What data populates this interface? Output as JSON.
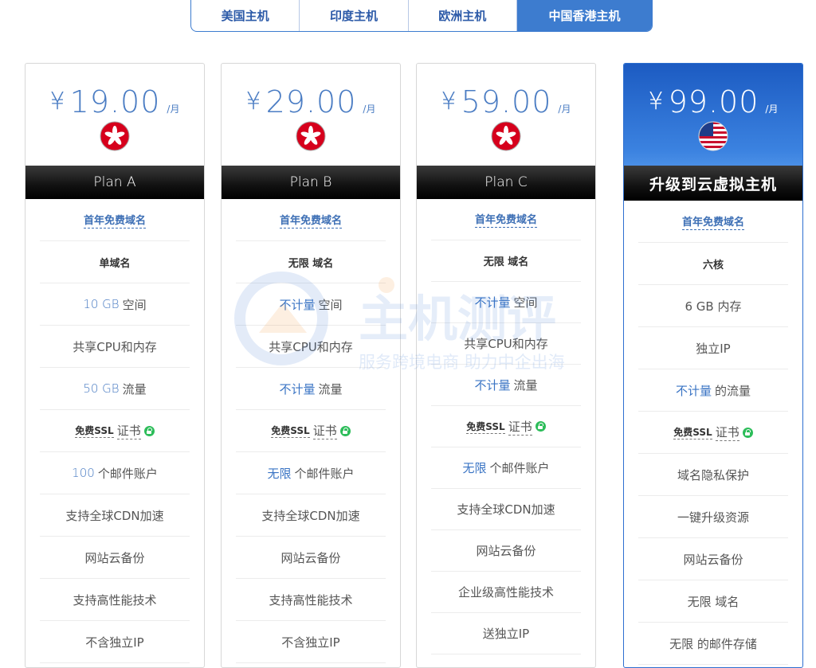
{
  "tabs": [
    {
      "label": "美国主机",
      "active": false
    },
    {
      "label": "印度主机",
      "active": false
    },
    {
      "label": "欧洲主机",
      "active": false
    },
    {
      "label": "中国香港主机",
      "active": true
    }
  ],
  "colors": {
    "accent": "#3d7ccf",
    "feature_blue": "#4a7cc3",
    "featured_header": "#1c5bc2",
    "ssl_green": "#2dbd5a"
  },
  "watermark": {
    "title": "主机测评",
    "subtitle": "服务跨境电商 助力中企出海"
  },
  "cards": [
    {
      "currency": "¥",
      "price": "19.00",
      "period": "/月",
      "flag": "hong-kong-flag-icon",
      "plan": "Plan A",
      "features": {
        "domain_link": "首年免费域名",
        "domains": "单域名",
        "storage_value": "10 GB",
        "storage_label": "空间",
        "cpu": "共享CPU和内存",
        "traffic_value": "50 GB",
        "traffic_label": "流量",
        "ssl_tag": "免费SSL",
        "ssl_label": "证书",
        "email_value": "100",
        "email_label": "个邮件账户",
        "f8": "支持全球CDN加速",
        "f9": "网站云备份",
        "f10": "支持高性能技术",
        "f11": "不含独立IP"
      }
    },
    {
      "currency": "¥",
      "price": "29.00",
      "period": "/月",
      "flag": "hong-kong-flag-icon",
      "plan": "Plan B",
      "features": {
        "domain_link": "首年免费域名",
        "domains": "无限 域名",
        "storage_value": "不计量",
        "storage_label": "空间",
        "cpu": "共享CPU和内存",
        "traffic_value": "不计量",
        "traffic_label": "流量",
        "ssl_tag": "免费SSL",
        "ssl_label": "证书",
        "email_value": "无限",
        "email_label": "个邮件账户",
        "f8": "支持全球CDN加速",
        "f9": "网站云备份",
        "f10": "支持高性能技术",
        "f11": "不含独立IP"
      }
    },
    {
      "currency": "¥",
      "price": "59.00",
      "period": "/月",
      "flag": "hong-kong-flag-icon",
      "plan": "Plan C",
      "features": {
        "domain_link": "首年免费域名",
        "domains": "无限 域名",
        "storage_value": "不计量",
        "storage_label": "空间",
        "cpu": "共享CPU和内存",
        "traffic_value": "不计量",
        "traffic_label": "流量",
        "ssl_tag": "免费SSL",
        "ssl_label": "证书",
        "email_value": "无限",
        "email_label": "个邮件账户",
        "f8": "支持全球CDN加速",
        "f9": "网站云备份",
        "f10": "企业级高性能技术",
        "f11": "送独立IP"
      }
    },
    {
      "currency": "¥",
      "price": "99.00",
      "period": "/月",
      "flag": "usa-flag-icon",
      "plan": "升级到云虚拟主机",
      "features": {
        "domain_link": "首年免费域名",
        "cores": "六核",
        "memory": "6 GB 内存",
        "ip": "独立IP",
        "traffic_value": "不计量",
        "traffic_label": "的流量",
        "ssl_tag": "免费SSL",
        "ssl_label": "证书",
        "privacy": "域名隐私保护",
        "upgrade": "一键升级资源",
        "backup": "网站云备份",
        "domains": "无限 域名",
        "email": "无限 的邮件存储"
      }
    }
  ]
}
